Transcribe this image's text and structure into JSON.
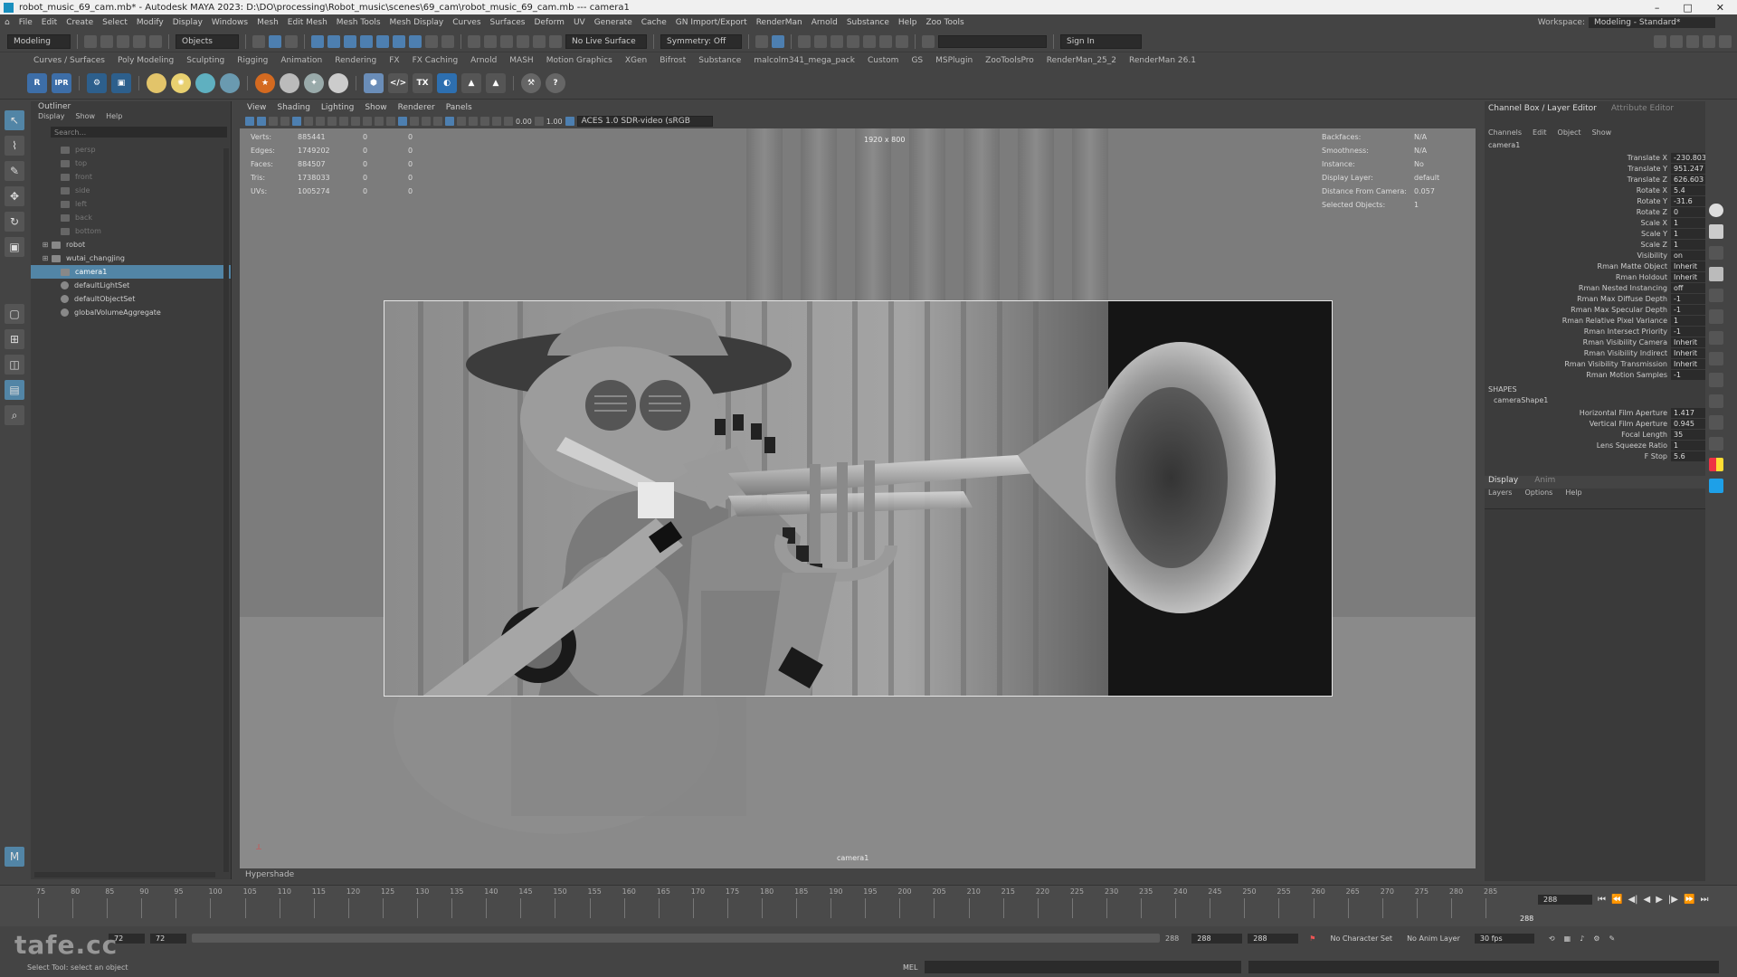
{
  "titlebar": {
    "title": "robot_music_69_cam.mb* - Autodesk MAYA 2023: D:\\DO\\processing\\Robot_music\\scenes\\69_cam\\robot_music_69_cam.mb   ---   camera1"
  },
  "menubar": {
    "items": [
      "File",
      "Edit",
      "Create",
      "Select",
      "Modify",
      "Display",
      "Windows",
      "Mesh",
      "Edit Mesh",
      "Mesh Tools",
      "Mesh Display",
      "Curves",
      "Surfaces",
      "Deform",
      "UV",
      "Generate",
      "Cache",
      "GN Import/Export",
      "RenderMan",
      "Arnold",
      "Substance",
      "Help",
      "Zoo Tools"
    ],
    "workspace_label": "Workspace:",
    "workspace_value": "Modeling - Standard*"
  },
  "statusline": {
    "mode": "Modeling",
    "objects": "Objects",
    "live_surface": "No Live Surface",
    "symmetry": "Symmetry: Off",
    "sign_in": "Sign In"
  },
  "shelf": {
    "tabs": [
      "Curves / Surfaces",
      "Poly Modeling",
      "Sculpting",
      "Rigging",
      "Animation",
      "Rendering",
      "FX",
      "FX Caching",
      "Arnold",
      "MASH",
      "Motion Graphics",
      "XGen",
      "Bifrost",
      "Substance",
      "malcolm341_mega_pack",
      "Custom",
      "GS",
      "MSPlugin",
      "ZooToolsPro",
      "RenderMan_25_2",
      "RenderMan 26.1"
    ],
    "ipr": "IPR",
    "r": "R",
    "tx": "TX"
  },
  "outliner": {
    "title": "Outliner",
    "menu": [
      "Display",
      "Show",
      "Help"
    ],
    "search_placeholder": "Search...",
    "items": [
      {
        "label": "persp",
        "state": "dim"
      },
      {
        "label": "top",
        "state": "dim"
      },
      {
        "label": "front",
        "state": "dim"
      },
      {
        "label": "side",
        "state": "dim"
      },
      {
        "label": "left",
        "state": "dim"
      },
      {
        "label": "back",
        "state": "dim"
      },
      {
        "label": "bottom",
        "state": "dim"
      },
      {
        "label": "robot",
        "state": "group"
      },
      {
        "label": "wutai_changjing",
        "state": "group"
      },
      {
        "label": "camera1",
        "state": "selected"
      },
      {
        "label": "defaultLightSet",
        "state": "set"
      },
      {
        "label": "defaultObjectSet",
        "state": "set"
      },
      {
        "label": "globalVolumeAggregate",
        "state": "set"
      }
    ]
  },
  "viewport": {
    "menu": [
      "View",
      "Shading",
      "Lighting",
      "Show",
      "Renderer",
      "Panels"
    ],
    "exposure": "0.00",
    "gamma": "1.00",
    "colorspace": "ACES 1.0 SDR-video (sRGB",
    "resolution": "1920 x 800",
    "camera_label": "camera1",
    "hud_left": [
      {
        "k": "Verts:",
        "v": "885441",
        "a": "0",
        "b": "0"
      },
      {
        "k": "Edges:",
        "v": "1749202",
        "a": "0",
        "b": "0"
      },
      {
        "k": "Faces:",
        "v": "884507",
        "a": "0",
        "b": "0"
      },
      {
        "k": "Tris:",
        "v": "1738033",
        "a": "0",
        "b": "0"
      },
      {
        "k": "UVs:",
        "v": "1005274",
        "a": "0",
        "b": "0"
      }
    ],
    "hud_right": [
      {
        "k": "Backfaces:",
        "v": "N/A"
      },
      {
        "k": "Smoothness:",
        "v": "N/A"
      },
      {
        "k": "Instance:",
        "v": "No"
      },
      {
        "k": "Display Layer:",
        "v": "default"
      },
      {
        "k": "Distance From Camera:",
        "v": "0.057"
      },
      {
        "k": "Selected Objects:",
        "v": "1"
      }
    ]
  },
  "hypershade": {
    "label": "Hypershade"
  },
  "channel_box": {
    "tab_active": "Channel Box / Layer Editor",
    "tab_inactive": "Attribute Editor",
    "menu": [
      "Channels",
      "Edit",
      "Object",
      "Show"
    ],
    "object": "camera1",
    "attrs": [
      {
        "n": "Translate X",
        "v": "-230.803"
      },
      {
        "n": "Translate Y",
        "v": "951.247"
      },
      {
        "n": "Translate Z",
        "v": "626.603"
      },
      {
        "n": "Rotate X",
        "v": "5.4"
      },
      {
        "n": "Rotate Y",
        "v": "-31.6"
      },
      {
        "n": "Rotate Z",
        "v": "0"
      },
      {
        "n": "Scale X",
        "v": "1"
      },
      {
        "n": "Scale Y",
        "v": "1"
      },
      {
        "n": "Scale Z",
        "v": "1"
      },
      {
        "n": "Visibility",
        "v": "on"
      },
      {
        "n": "Rman Matte Object",
        "v": "Inherit"
      },
      {
        "n": "Rman Holdout",
        "v": "Inherit"
      },
      {
        "n": "Rman Nested Instancing",
        "v": "off"
      },
      {
        "n": "Rman Max Diffuse Depth",
        "v": "-1"
      },
      {
        "n": "Rman Max Specular Depth",
        "v": "-1"
      },
      {
        "n": "Rman Relative Pixel Variance",
        "v": "1"
      },
      {
        "n": "Rman Intersect Priority",
        "v": "-1"
      },
      {
        "n": "Rman Visibility Camera",
        "v": "Inherit"
      },
      {
        "n": "Rman Visibility Indirect",
        "v": "Inherit"
      },
      {
        "n": "Rman Visibility Transmission",
        "v": "Inherit"
      },
      {
        "n": "Rman Motion Samples",
        "v": "-1"
      }
    ],
    "shapes_label": "SHAPES",
    "shape_name": "cameraShape1",
    "shape_attrs": [
      {
        "n": "Horizontal Film Aperture",
        "v": "1.417"
      },
      {
        "n": "Vertical Film Aperture",
        "v": "0.945"
      },
      {
        "n": "Focal Length",
        "v": "35"
      },
      {
        "n": "Lens Squeeze Ratio",
        "v": "1"
      },
      {
        "n": "F Stop",
        "v": "5.6"
      }
    ],
    "layer_tabs": [
      "Display",
      "Anim"
    ],
    "layer_menu": [
      "Layers",
      "Options",
      "Help"
    ]
  },
  "timeline": {
    "ticks": [
      "75",
      "80",
      "85",
      "90",
      "95",
      "100",
      "105",
      "110",
      "115",
      "120",
      "125",
      "130",
      "135",
      "140",
      "145",
      "150",
      "155",
      "160",
      "165",
      "170",
      "175",
      "180",
      "185",
      "190",
      "195",
      "200",
      "205",
      "210",
      "215",
      "220",
      "225",
      "230",
      "235",
      "240",
      "245",
      "250",
      "255",
      "260",
      "265",
      "270",
      "275",
      "280",
      "285"
    ],
    "current_frame": "288",
    "playhead_label": "288"
  },
  "range": {
    "start": "72",
    "inner_start": "72",
    "inner_end": "288",
    "range_end_a": "288",
    "range_end_b": "288",
    "char_set": "No Character Set",
    "anim_layer": "No Anim Layer",
    "fps": "30 fps"
  },
  "cmdline": {
    "mel": "MEL",
    "help": "Select Tool: select an object"
  },
  "watermark": "tafe.cc",
  "colors": {
    "accent": "#5285a6",
    "panel": "#444444",
    "field": "#2b2b2b"
  }
}
